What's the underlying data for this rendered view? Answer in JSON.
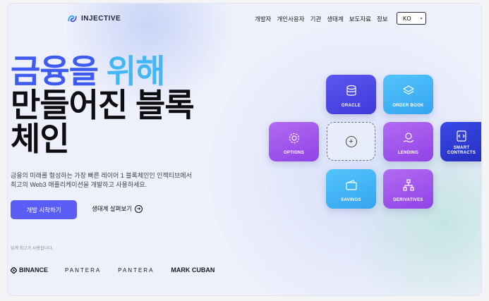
{
  "brand": {
    "name": "INJECTIVE"
  },
  "nav": {
    "items": [
      "개발자",
      "개인사용자",
      "기관",
      "생태계",
      "보도자료",
      "정보"
    ]
  },
  "language": {
    "selected": "KO"
  },
  "hero": {
    "title_part1": "금융을 ",
    "title_part2": "위해",
    "title_line2": "만들어진 블록",
    "title_line3": "체인",
    "subtitle_line1": "금융의 미래를 형성하는 가장 빠른 레이어 1 블록체인인 인젝티브에서",
    "subtitle_line2": "최고의 Web3 애플리케이션을 개발하고 사용하세요.",
    "cta_primary": "개발 시작하기",
    "cta_secondary": "생태계 살펴보기"
  },
  "trusted": {
    "caption": "업계 최고가 사용합니다."
  },
  "partners": [
    "BINANCE",
    "PANTERA",
    "PANTERA",
    "MARK CUBAN"
  ],
  "tiles": {
    "oracle": "ORACLE",
    "order_book": "ORDER BOOK",
    "options": "OPTIONS",
    "lending": "LENDING",
    "smart_contracts_1": "SMART",
    "smart_contracts_2": "CONTRACTS",
    "savings": "SAVINGS",
    "derivatives": "DERIVATIVES"
  },
  "icons": [
    "injective-logo-icon",
    "chevron-icon",
    "arrow-right-circle-icon",
    "binance-logo-icon",
    "database-icon",
    "layers-icon",
    "gear-icon",
    "plus-icon",
    "hand-coin-icon",
    "code-icon",
    "wallet-icon",
    "network-icon"
  ],
  "colors": {
    "accent": "#5b5ef5",
    "title_blue": "#3d5bf0",
    "title_cyan": "#43b6f5",
    "tile_violet": "#9d50ea",
    "tile_sky": "#41b3f6",
    "tile_indigo": "#4a46e4"
  }
}
